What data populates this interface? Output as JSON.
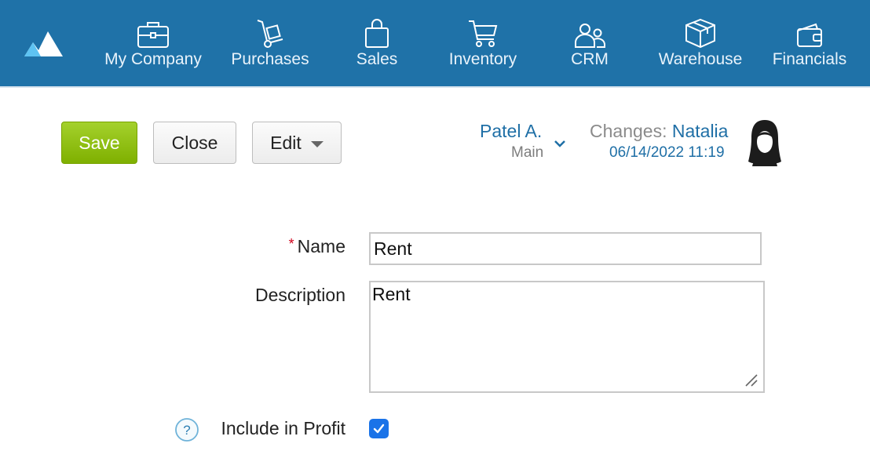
{
  "nav": {
    "items": [
      {
        "label": "My Company",
        "icon": "briefcase-icon"
      },
      {
        "label": "Purchases",
        "icon": "hand-truck-icon"
      },
      {
        "label": "Sales",
        "icon": "shopping-bag-icon"
      },
      {
        "label": "Inventory",
        "icon": "cart-icon"
      },
      {
        "label": "CRM",
        "icon": "people-icon"
      },
      {
        "label": "Warehouse",
        "icon": "box-icon"
      },
      {
        "label": "Financials",
        "icon": "wallet-icon"
      }
    ],
    "bar_color": "#1f72a8",
    "logo_icon": "mountains-logo"
  },
  "toolbar": {
    "save_label": "Save",
    "close_label": "Close",
    "edit_label": "Edit"
  },
  "owner": {
    "name": "Patel A.",
    "org": "Main"
  },
  "changes": {
    "label": "Changes:",
    "user": "Natalia",
    "date": "06/14/2022 11:19"
  },
  "form": {
    "name_required_mark": "*",
    "name_label": "Name",
    "name_value": "Rent",
    "description_label": "Description",
    "description_value": "Rent",
    "include_profit_label": "Include in Profit",
    "include_profit_checked": true
  },
  "colors": {
    "save_green": "#8cc010",
    "link_blue": "#1f6fa6",
    "checkbox_blue": "#1a73e8",
    "required_red": "#d0021b"
  }
}
